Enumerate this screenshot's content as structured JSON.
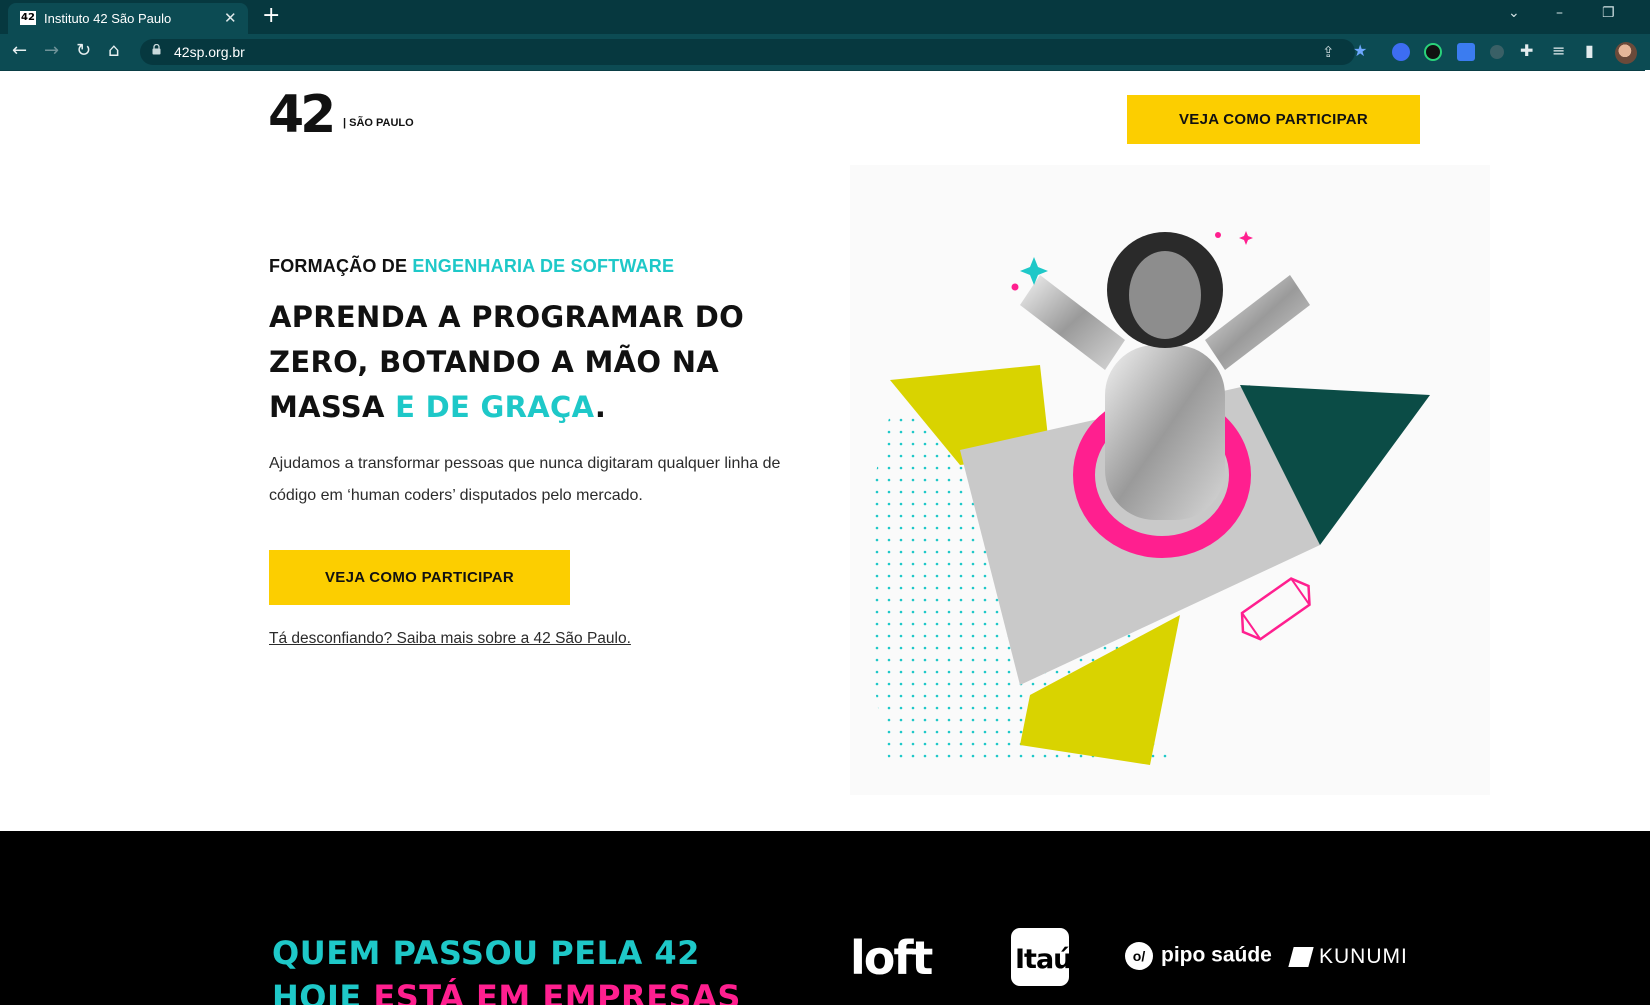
{
  "browser": {
    "tab_title": "Instituto 42 São Paulo",
    "favicon_text": "42",
    "url": "42sp.org.br"
  },
  "header": {
    "logo_number": "42",
    "logo_city": "| SÃO PAULO",
    "cta_label": "VEJA COMO PARTICIPAR"
  },
  "hero": {
    "eyebrow_prefix": "FORMAÇÃO DE ",
    "eyebrow_highlight": "ENGENHARIA DE SOFTWARE",
    "headline_main": "APRENDA A PROGRAMAR DO ZERO, BOTANDO A MÃO NA MASSA ",
    "headline_highlight": "E DE GRAÇA",
    "headline_end": ".",
    "lead": "Ajudamos a transformar pessoas que nunca digitaram qualquer linha de código em ‘human coders’ disputados pelo mercado.",
    "cta_label": "VEJA COMO PARTICIPAR",
    "trust_link": "Tá desconfiando? Saiba mais sobre a 42 São Paulo."
  },
  "band": {
    "title_line1": "QUEM PASSOU PELA 42",
    "title_line2_teal": "HOJE ",
    "title_line2_pink": "ESTÁ EM EMPRESAS",
    "partners": {
      "loft": "loft",
      "itau": "Itaú",
      "pipo": "pipo saúde",
      "pipo_mark": "o/",
      "kunumi": "KUNUMI"
    }
  },
  "colors": {
    "accent_yellow": "#fcce00",
    "accent_teal": "#1ec8c8",
    "accent_pink": "#ff1f8f",
    "chrome_dark": "#06383f"
  },
  "icons": [
    "back-icon",
    "forward-icon",
    "reload-icon",
    "home-icon",
    "lock-icon",
    "share-icon",
    "star-icon",
    "extensions-icon",
    "sidepanel-icon",
    "close-icon",
    "new-tab-icon"
  ]
}
